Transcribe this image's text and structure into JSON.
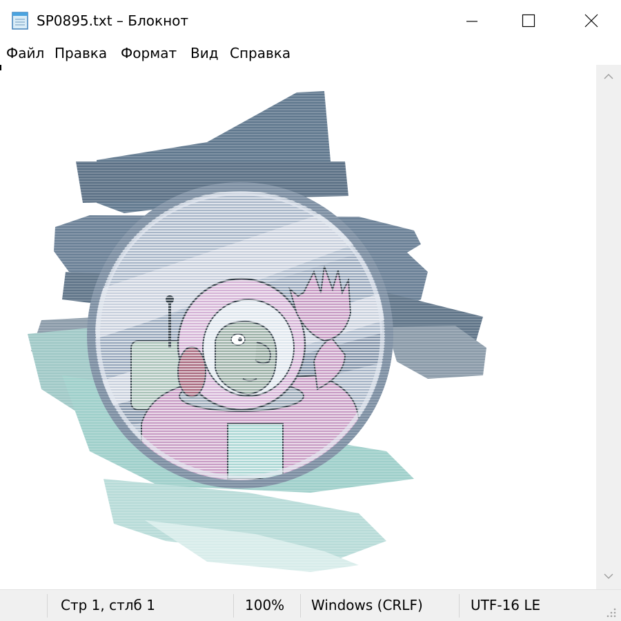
{
  "window": {
    "title": "SP0895.txt – Блокнот",
    "icon": "notepad-icon",
    "controls": [
      "minimize-icon",
      "maximize-icon",
      "close-icon"
    ]
  },
  "menu": [
    "Файл",
    "Правка",
    "Формат",
    "Вид",
    "Справка"
  ],
  "document": {
    "content": "ASCII/ANSI art of a cartoon astronaut waving from a round porthole"
  },
  "statusbar": {
    "position": "Стр 1, стлб 1",
    "zoom": "100%",
    "line_endings": "Windows (CRLF)",
    "encoding": "UTF-16 LE"
  },
  "colors": {
    "slate": "#566a7e",
    "steel": "#8b9cb0",
    "porthole_glass": "#aab8cc",
    "teal": "#8ec9c4",
    "suit_pink": "#c79bc4",
    "face": "#9bb0a6"
  }
}
